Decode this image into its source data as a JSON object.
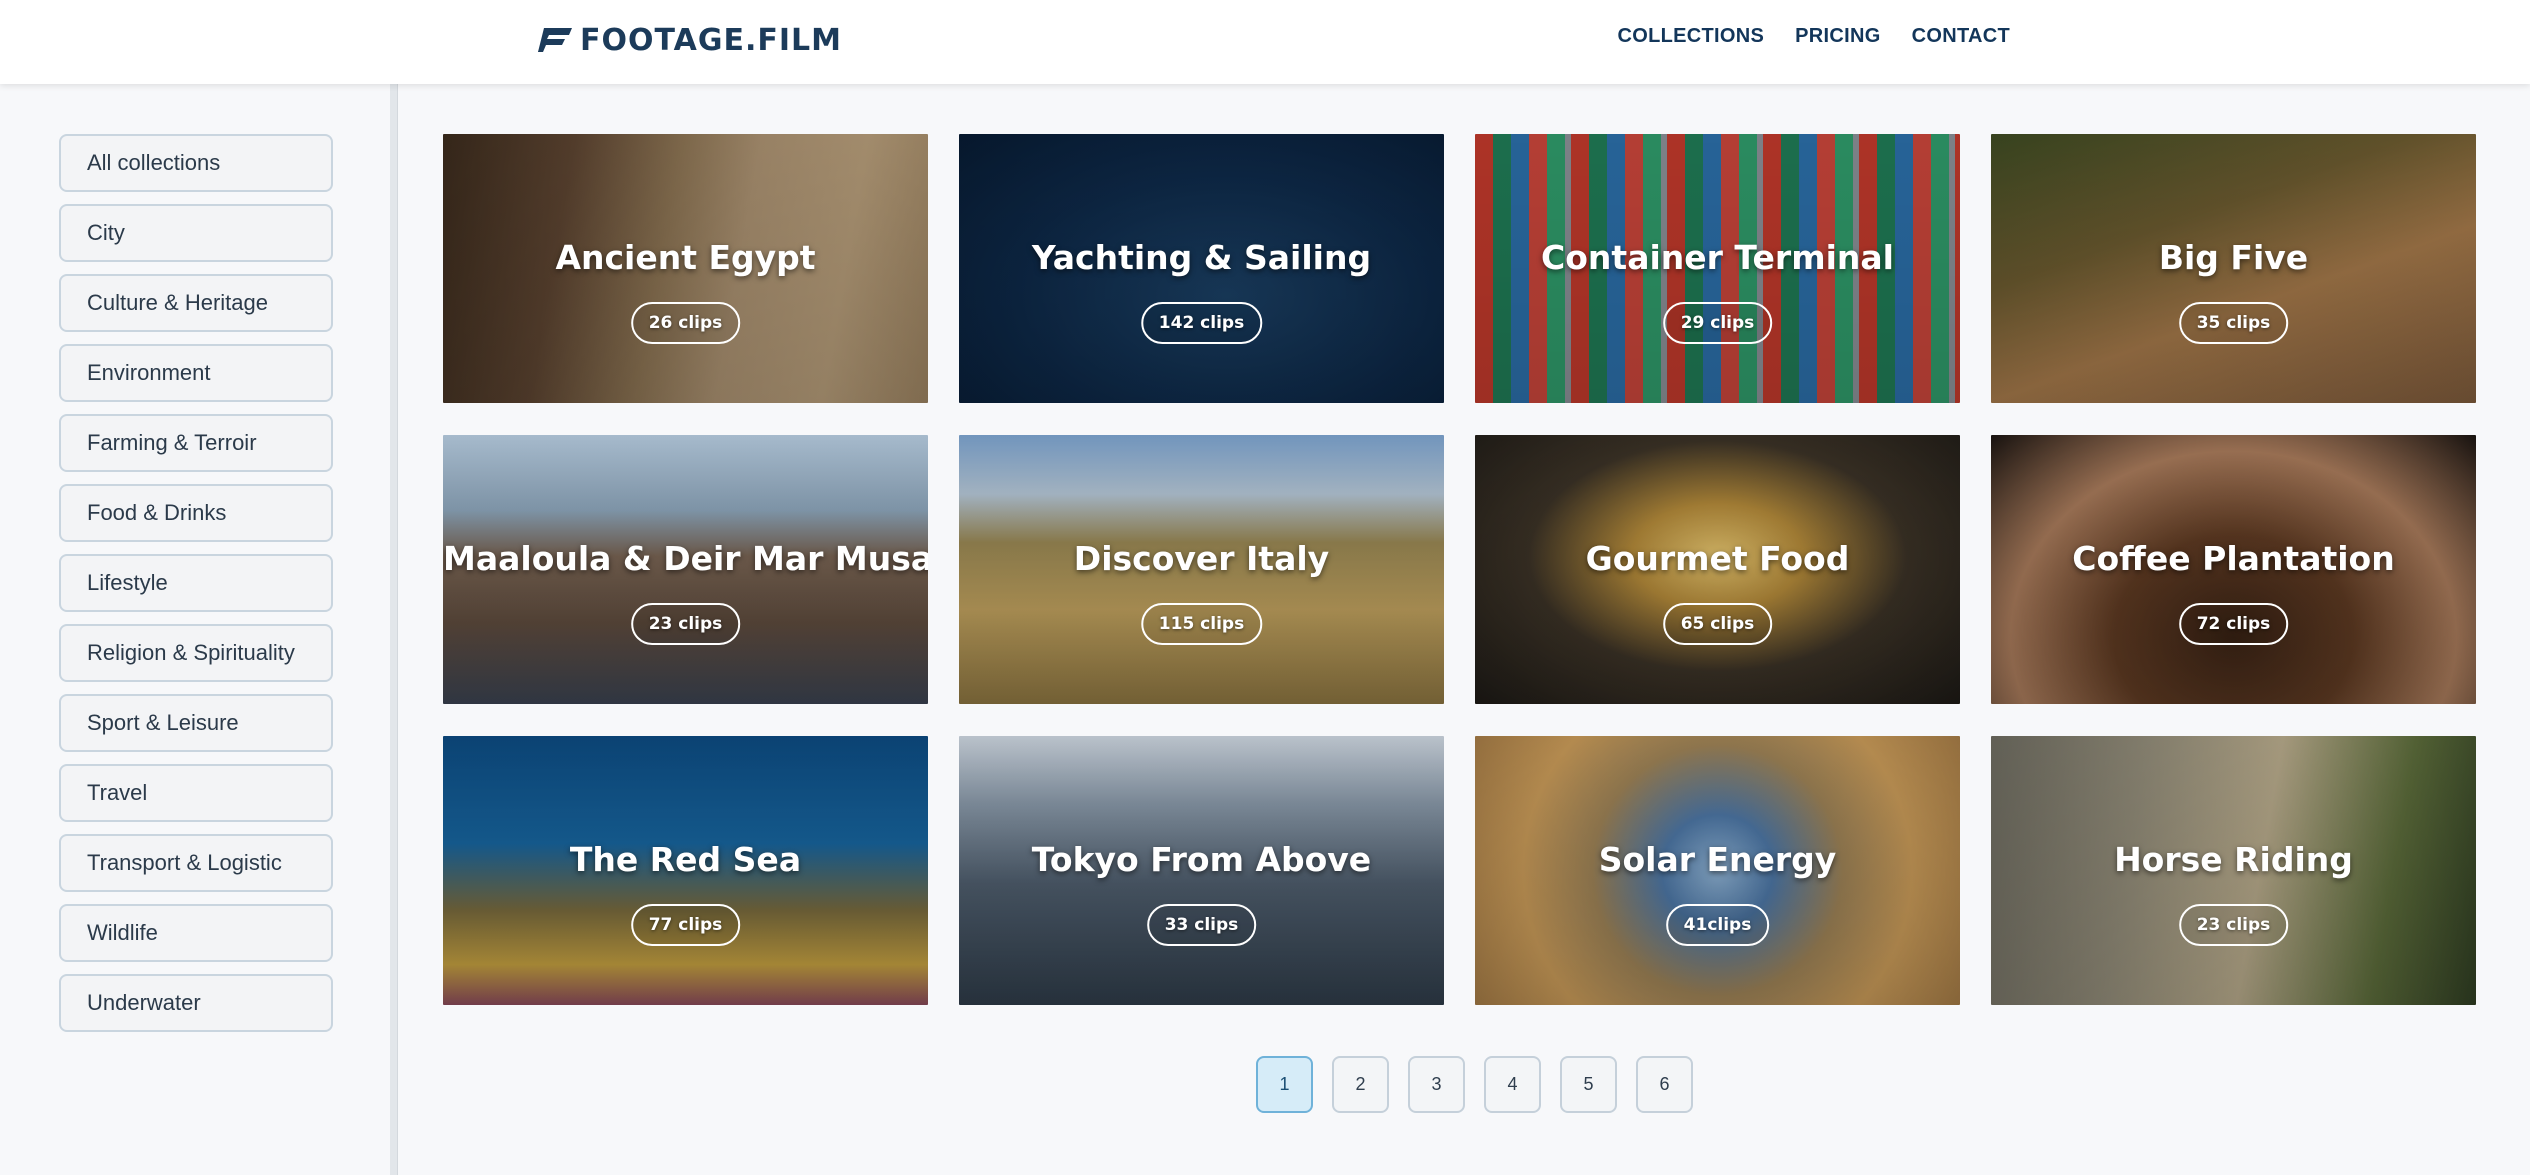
{
  "header": {
    "logo_text": "FOOTAGE.FILM",
    "nav": [
      "COLLECTIONS",
      "PRICING",
      "CONTACT"
    ]
  },
  "sidebar": {
    "categories": [
      "All collections",
      "City",
      "Culture & Heritage",
      "Environment",
      "Farming & Terroir",
      "Food & Drinks",
      "Lifestyle",
      "Religion & Spirituality",
      "Sport & Leisure",
      "Travel",
      "Transport & Logistic",
      "Wildlife",
      "Underwater"
    ]
  },
  "collections": [
    {
      "title": "Ancient Egypt",
      "clips": "26 clips"
    },
    {
      "title": "Yachting & Sailing",
      "clips": "142 clips"
    },
    {
      "title": "Container Terminal",
      "clips": "29 clips"
    },
    {
      "title": "Big Five",
      "clips": "35 clips"
    },
    {
      "title": "Maaloula & Deir Mar Musa",
      "clips": "23 clips"
    },
    {
      "title": "Discover Italy",
      "clips": "115 clips"
    },
    {
      "title": "Gourmet Food",
      "clips": "65 clips"
    },
    {
      "title": "Coffee Plantation",
      "clips": "72 clips"
    },
    {
      "title": "The Red Sea",
      "clips": "77 clips"
    },
    {
      "title": "Tokyo From Above",
      "clips": "33 clips"
    },
    {
      "title": "Solar Energy",
      "clips": "41clips"
    },
    {
      "title": "Horse Riding",
      "clips": "23 clips"
    }
  ],
  "pagination": {
    "pages": [
      "1",
      "2",
      "3",
      "4",
      "5",
      "6"
    ],
    "current": "1"
  },
  "colors": {
    "brand": "#1c3b5a",
    "active_page_bg": "#d6ecf8",
    "active_page_border": "#6fb2d9"
  }
}
